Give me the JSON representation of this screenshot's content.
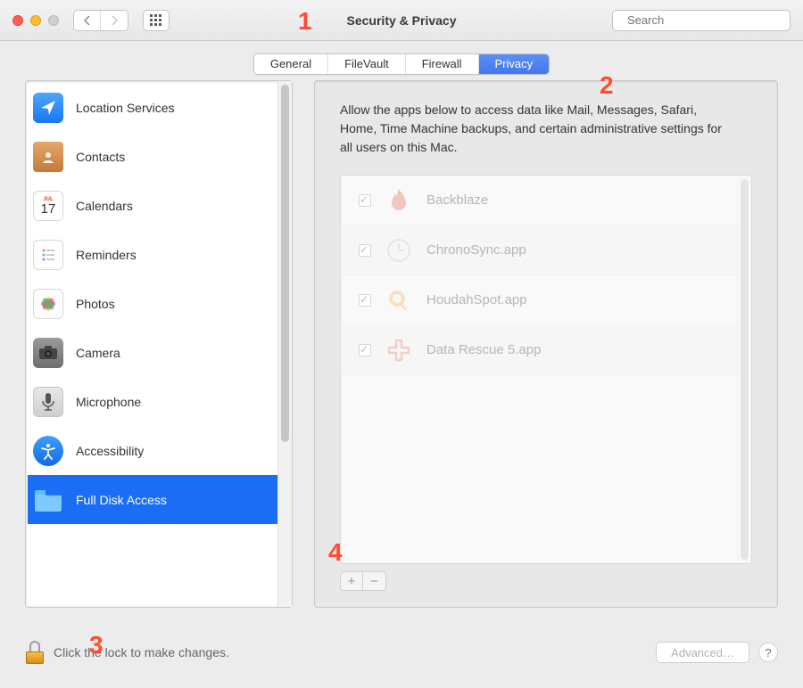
{
  "window": {
    "title": "Security & Privacy",
    "search_placeholder": "Search"
  },
  "tabs": [
    {
      "label": "General",
      "selected": false
    },
    {
      "label": "FileVault",
      "selected": false
    },
    {
      "label": "Firewall",
      "selected": false
    },
    {
      "label": "Privacy",
      "selected": true
    }
  ],
  "categories": [
    {
      "id": "location",
      "label": "Location Services"
    },
    {
      "id": "contacts",
      "label": "Contacts"
    },
    {
      "id": "calendars",
      "label": "Calendars",
      "badge": "17",
      "mon": "JUL"
    },
    {
      "id": "reminders",
      "label": "Reminders"
    },
    {
      "id": "photos",
      "label": "Photos"
    },
    {
      "id": "camera",
      "label": "Camera"
    },
    {
      "id": "microphone",
      "label": "Microphone"
    },
    {
      "id": "accessibility",
      "label": "Accessibility"
    },
    {
      "id": "full-disk-access",
      "label": "Full Disk Access",
      "selected": true
    }
  ],
  "detail": {
    "description": "Allow the apps below to access data like Mail, Messages, Safari, Home, Time Machine backups, and certain administrative settings for all users on this Mac.",
    "apps": [
      {
        "name": "Backblaze",
        "checked": true
      },
      {
        "name": "ChronoSync.app",
        "checked": true
      },
      {
        "name": "HoudahSpot.app",
        "checked": true
      },
      {
        "name": "Data Rescue 5.app",
        "checked": true
      }
    ],
    "add_label": "+",
    "remove_label": "−"
  },
  "footer": {
    "lock_message": "Click the lock to make changes.",
    "advanced_label": "Advanced…",
    "help_label": "?"
  },
  "annotations": {
    "a1": "1",
    "a2": "2",
    "a3": "3",
    "a4": "4"
  }
}
